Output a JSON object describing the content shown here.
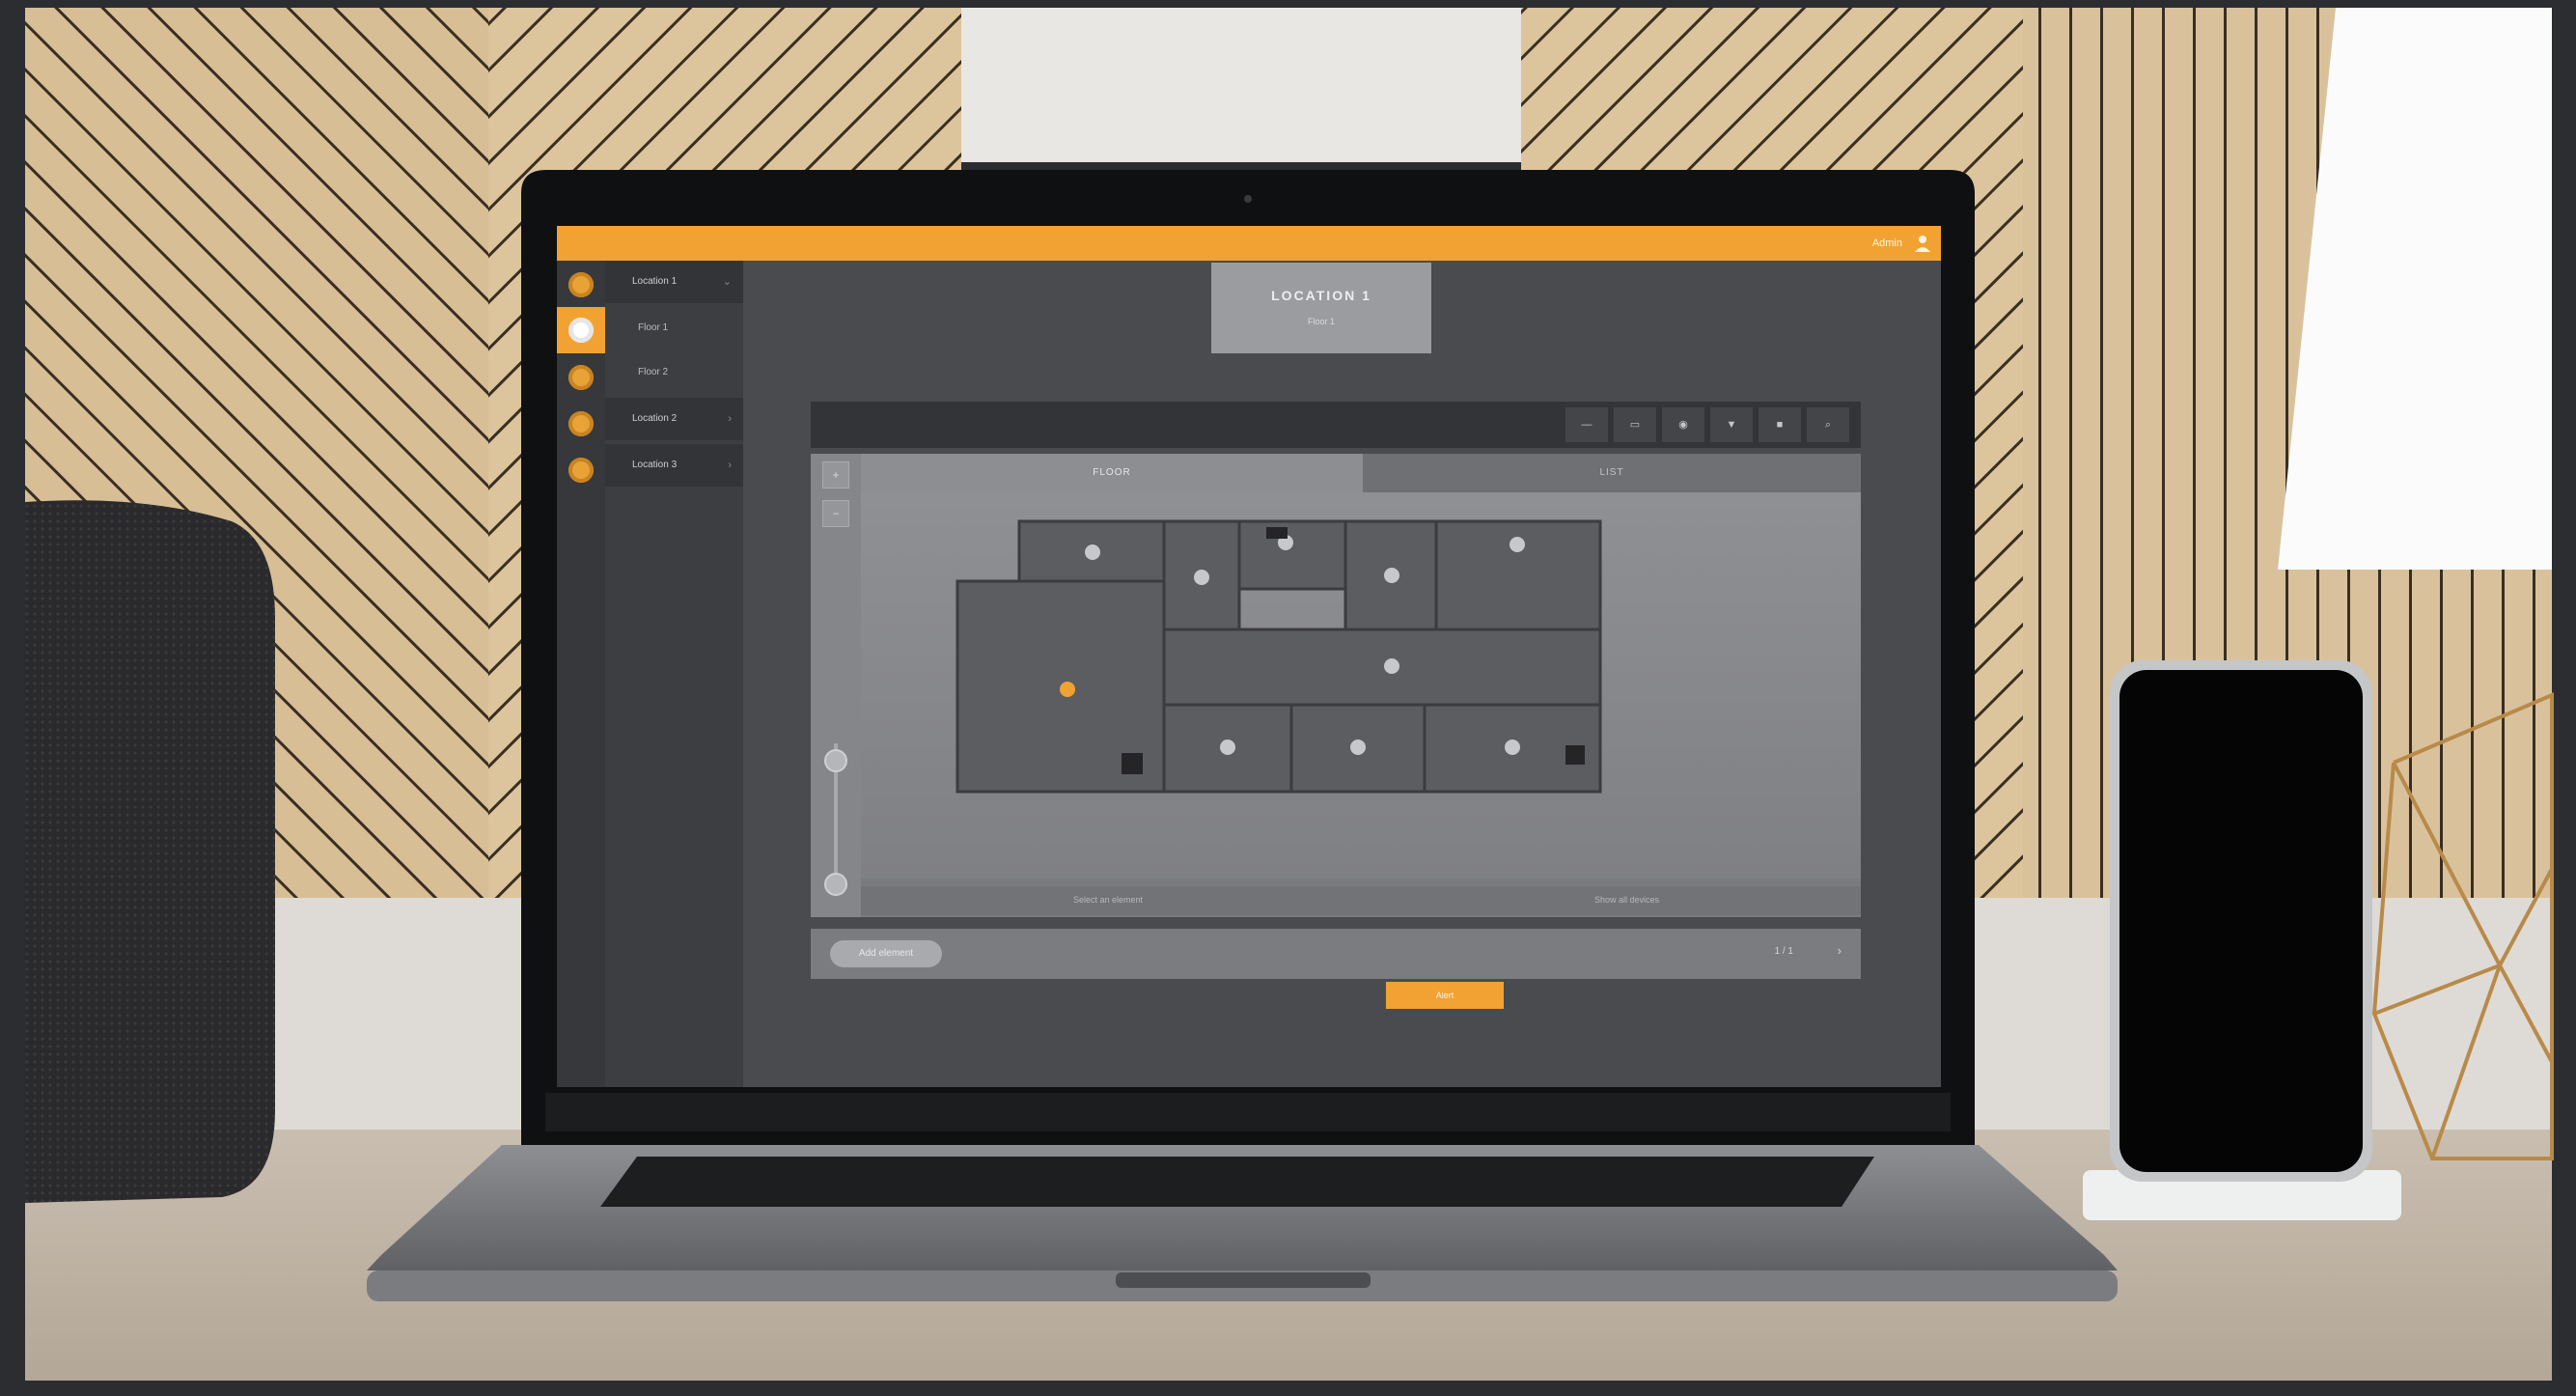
{
  "app": {
    "topbar": {
      "user_label": "Admin"
    },
    "rail": {
      "icons": [
        "location-icon",
        "floor-icon",
        "location-icon",
        "location-icon",
        "location-icon"
      ]
    },
    "nav": {
      "items": [
        {
          "label": "Location 1",
          "type": "header"
        },
        {
          "label": "Floor 1",
          "type": "sub"
        },
        {
          "label": "Floor 2",
          "type": "sub"
        },
        {
          "label": "Location 2",
          "type": "header"
        },
        {
          "label": "Location 3",
          "type": "header"
        }
      ]
    },
    "location_card": {
      "title": "LOCATION 1",
      "subtitle": "Floor 1"
    },
    "toolbar": {
      "buttons": [
        "—",
        "▭",
        "◉",
        "▼",
        "■",
        "⌕"
      ]
    },
    "viewer": {
      "tabs": {
        "active": "FLOOR",
        "inactive": "LIST"
      },
      "zoom": {
        "in": "+",
        "out": "−"
      },
      "footer": {
        "left": "Select an element",
        "right": "Show all devices"
      },
      "badge": "Alert"
    },
    "bottombar": {
      "pill": "Add element",
      "label": "1 / 1",
      "chevron": "›"
    }
  },
  "colors": {
    "accent": "#f2a233",
    "panel_dark": "#37383b",
    "wall_left": "#d8c19a",
    "desk": "#bfb3a5"
  }
}
